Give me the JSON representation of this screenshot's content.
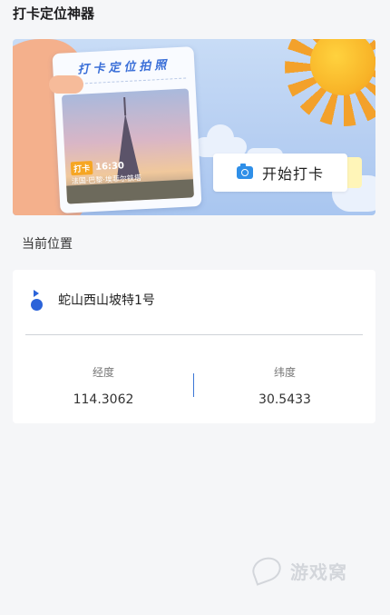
{
  "page": {
    "title": "打卡定位神器"
  },
  "banner": {
    "ticket_title": "打卡定位拍照",
    "stamp_tag": "打卡",
    "stamp_time": "16:30",
    "stamp_location": "法国·巴黎·埃菲尔铁塔",
    "start_button_label": "开始打卡",
    "colors": {
      "accent": "#2f8fe8",
      "sun": "#f8b428",
      "sky": "#b7cff2"
    }
  },
  "location": {
    "section_label": "当前位置",
    "address": "蛇山西山坡特1号",
    "longitude_label": "经度",
    "longitude_value": "114.3062",
    "latitude_label": "纬度",
    "latitude_value": "30.5433"
  },
  "watermark": {
    "text": "游戏窝"
  }
}
